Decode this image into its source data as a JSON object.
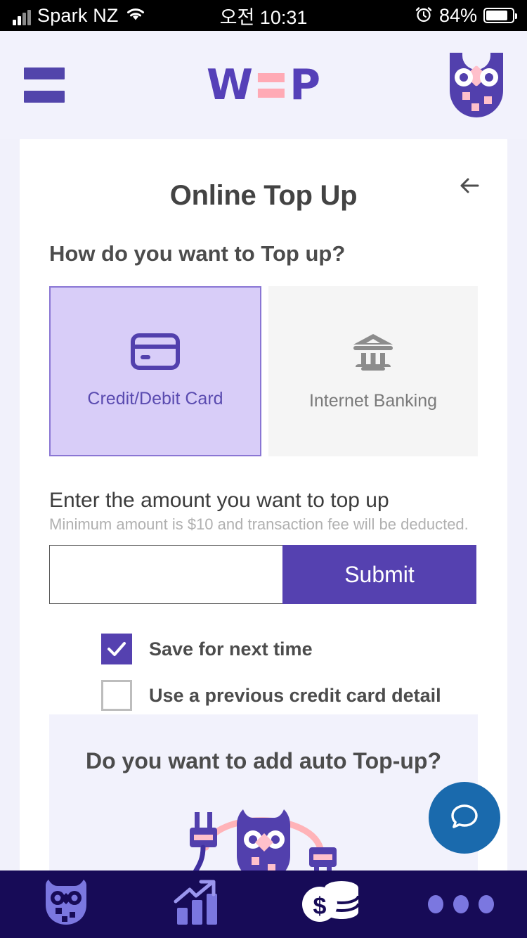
{
  "status_bar": {
    "carrier": "Spark NZ",
    "time": "오전 10:31",
    "battery": "84%",
    "signal_icon": "cellular-signal-icon",
    "wifi_icon": "wifi-icon",
    "alarm_icon": "alarm-clock-icon",
    "battery_icon": "battery-icon"
  },
  "header": {
    "menu_icon": "hamburger-menu-icon",
    "logo_left": "W",
    "logo_right": "P",
    "logo_separator_icon": "equals-icon",
    "avatar_icon": "owl-avatar-icon"
  },
  "main": {
    "back_icon": "back-arrow-icon",
    "title": "Online Top Up",
    "question": "How do you want to Top up?",
    "methods": [
      {
        "label": "Credit/Debit Card",
        "icon": "credit-card-icon",
        "selected": true
      },
      {
        "label": "Internet Banking",
        "icon": "bank-icon",
        "selected": false
      }
    ],
    "amount_label": "Enter the amount you want to top up",
    "amount_hint": "Minimum amount is $10 and transaction fee will be deducted.",
    "amount_value": "",
    "amount_placeholder": "",
    "currency_symbol": "$",
    "submit_label": "Submit",
    "checkboxes": [
      {
        "label": "Save for next time",
        "checked": true
      },
      {
        "label": "Use a previous credit card detail",
        "checked": false
      }
    ],
    "auto_topup_title": "Do you want to add auto Top-up?",
    "auto_topup_illustration": "owl-with-plugs-illustration"
  },
  "chat_button": {
    "icon": "chat-bubble-icon"
  },
  "bottom_nav": [
    {
      "name": "home",
      "icon": "owl-icon",
      "active": false
    },
    {
      "name": "stats",
      "icon": "bar-chart-trend-icon",
      "active": false
    },
    {
      "name": "topup",
      "icon": "coins-dollar-icon",
      "active": true
    },
    {
      "name": "more",
      "icon": "three-dots-icon",
      "active": false
    }
  ],
  "colors": {
    "brand_purple": "#5541b0",
    "accent_pink": "#ffaab5",
    "page_bg": "#f2f2fc",
    "nav_bg": "#170b57",
    "chat_blue": "#1a6aad"
  }
}
